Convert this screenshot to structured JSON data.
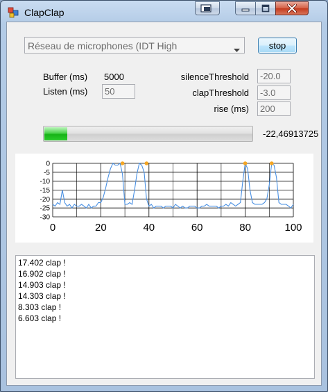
{
  "window": {
    "title": "ClapClap",
    "icon": "app-window-icon"
  },
  "controls": {
    "device_select": "Réseau de microphones (IDT High",
    "stop_label": "stop"
  },
  "params": {
    "buffer_label": "Buffer (ms)",
    "buffer_value": "5000",
    "listen_label": "Listen (ms)",
    "listen_value": "50",
    "silence_label": "silenceThreshold",
    "silence_value": "-20.0",
    "clap_label": "clapThreshold",
    "clap_value": "-3.0",
    "rise_label": "rise (ms)",
    "rise_value": "200"
  },
  "level": {
    "progress_fraction": 0.11,
    "value_text": "-22,46913725"
  },
  "chart_data": {
    "type": "line",
    "xlim": [
      0,
      100
    ],
    "ylim": [
      -30,
      0
    ],
    "x_ticks": [
      "0",
      "20",
      "40",
      "60",
      "80",
      "100"
    ],
    "y_ticks": [
      "0",
      "-5",
      "-10",
      "-15",
      "-20",
      "-25",
      "-30"
    ],
    "grid": true,
    "series": [
      {
        "color": "#4a90e2",
        "x": [
          0,
          1,
          2,
          3,
          4,
          5,
          6,
          7,
          8,
          9,
          10,
          11,
          12,
          13,
          14,
          15,
          16,
          17,
          18,
          19,
          20,
          21,
          22,
          23,
          24,
          25,
          26,
          27,
          28,
          29,
          30,
          31,
          32,
          33,
          34,
          35,
          36,
          37,
          38,
          39,
          40,
          41,
          42,
          43,
          44,
          45,
          46,
          47,
          48,
          49,
          50,
          51,
          52,
          53,
          54,
          55,
          56,
          57,
          58,
          59,
          60,
          61,
          62,
          63,
          64,
          65,
          66,
          67,
          68,
          69,
          70,
          71,
          72,
          73,
          74,
          75,
          76,
          77,
          78,
          79,
          80,
          81,
          82,
          83,
          84,
          85,
          86,
          87,
          88,
          89,
          90,
          91,
          92,
          93,
          94,
          95,
          96,
          97,
          98,
          99,
          100
        ],
        "values": [
          -23,
          -24,
          -22,
          -23,
          -15,
          -22,
          -24,
          -23,
          -25,
          -23,
          -24,
          -24,
          -23,
          -24,
          -25,
          -23,
          -25,
          -24,
          -24,
          -22,
          -22,
          -19,
          -14,
          -8,
          -3,
          0,
          -1,
          -1,
          0,
          -6,
          -23,
          -23,
          -22,
          -23,
          -15,
          -6,
          0,
          -1,
          -5,
          -20,
          -24,
          -23,
          -25,
          -24,
          -24,
          -24,
          -25,
          -24,
          -24,
          -24,
          -25,
          -23,
          -24,
          -25,
          -24,
          -25,
          -25,
          -24,
          -24,
          -24,
          -25,
          -25,
          -24,
          -24,
          -23,
          -24,
          -24,
          -24,
          -24,
          -25,
          -24,
          -24,
          -23,
          -24,
          -22,
          -23,
          -24,
          -23,
          -22,
          -10,
          0,
          -3,
          -15,
          -22,
          -23,
          -23,
          -23,
          -23,
          -22,
          -20,
          -12,
          0,
          -1,
          -8,
          -22,
          -23,
          -23,
          -23,
          -24,
          -25,
          -23
        ]
      }
    ],
    "markers": [
      {
        "x": 29,
        "y": 0,
        "color": "#f5a623"
      },
      {
        "x": 39,
        "y": 0,
        "color": "#f5a623"
      },
      {
        "x": 80,
        "y": 0,
        "color": "#f5a623"
      },
      {
        "x": 91,
        "y": 0,
        "color": "#f5a623"
      }
    ]
  },
  "log": {
    "lines": [
      "17.402 clap !",
      "16.902 clap !",
      "14.903 clap !",
      "14.303 clap !",
      "8.303 clap !",
      "6.603 clap !"
    ]
  }
}
